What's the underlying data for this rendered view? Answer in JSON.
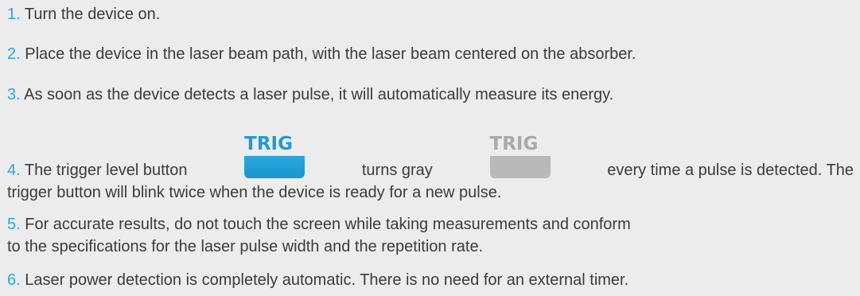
{
  "steps": [
    {
      "num": "1.",
      "text": "Turn the device on."
    },
    {
      "num": "2.",
      "text": "Place the device in the laser beam path, with the laser beam centered on the absorber."
    },
    {
      "num": "3.",
      "text": "As soon as the device detects a laser pulse, it will automatically measure its energy."
    },
    {
      "num": "4.",
      "text_before_button1": "The trigger level button",
      "button1_label": "TRIG",
      "text_between_buttons": "turns gray",
      "button2_label": "TRIG",
      "text_after_button2": "every time a pulse is detected. The",
      "text_line2": "trigger button will blink twice when the device is ready for a new pulse."
    },
    {
      "num": "5.",
      "text_line1": "For accurate results, do not touch the screen while taking measurements and conform",
      "text_line2": "to the specifications for the laser pulse width and the repetition rate."
    },
    {
      "num": "6.",
      "text": "Laser power detection is completely automatic. There is no need for an external timer."
    }
  ],
  "colors": {
    "number": "#2aa7df",
    "text": "#3b3b3b",
    "background": "#ececec",
    "trig_active": "#1f9bd6",
    "trig_inactive": "#b9b9b9"
  }
}
